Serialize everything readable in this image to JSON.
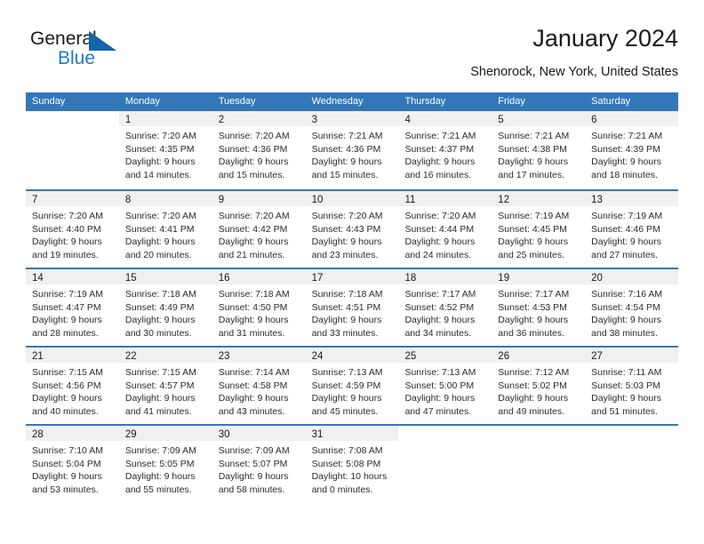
{
  "brand": {
    "name_part1": "General",
    "name_part2": "Blue",
    "accent_color": "#1d7bc4",
    "triangle_color": "#1665a8"
  },
  "header": {
    "title": "January 2024",
    "subtitle": "Shenorock, New York, United States"
  },
  "calendar": {
    "header_bg": "#3277b8",
    "daynum_bg": "#f0f0f0",
    "weekdays": [
      "Sunday",
      "Monday",
      "Tuesday",
      "Wednesday",
      "Thursday",
      "Friday",
      "Saturday"
    ],
    "weeks": [
      [
        {
          "day": "",
          "sunrise": "",
          "sunset": "",
          "daylight_line1": "",
          "daylight_line2": ""
        },
        {
          "day": "1",
          "sunrise": "Sunrise: 7:20 AM",
          "sunset": "Sunset: 4:35 PM",
          "daylight_line1": "Daylight: 9 hours",
          "daylight_line2": "and 14 minutes."
        },
        {
          "day": "2",
          "sunrise": "Sunrise: 7:20 AM",
          "sunset": "Sunset: 4:36 PM",
          "daylight_line1": "Daylight: 9 hours",
          "daylight_line2": "and 15 minutes."
        },
        {
          "day": "3",
          "sunrise": "Sunrise: 7:21 AM",
          "sunset": "Sunset: 4:36 PM",
          "daylight_line1": "Daylight: 9 hours",
          "daylight_line2": "and 15 minutes."
        },
        {
          "day": "4",
          "sunrise": "Sunrise: 7:21 AM",
          "sunset": "Sunset: 4:37 PM",
          "daylight_line1": "Daylight: 9 hours",
          "daylight_line2": "and 16 minutes."
        },
        {
          "day": "5",
          "sunrise": "Sunrise: 7:21 AM",
          "sunset": "Sunset: 4:38 PM",
          "daylight_line1": "Daylight: 9 hours",
          "daylight_line2": "and 17 minutes."
        },
        {
          "day": "6",
          "sunrise": "Sunrise: 7:21 AM",
          "sunset": "Sunset: 4:39 PM",
          "daylight_line1": "Daylight: 9 hours",
          "daylight_line2": "and 18 minutes."
        }
      ],
      [
        {
          "day": "7",
          "sunrise": "Sunrise: 7:20 AM",
          "sunset": "Sunset: 4:40 PM",
          "daylight_line1": "Daylight: 9 hours",
          "daylight_line2": "and 19 minutes."
        },
        {
          "day": "8",
          "sunrise": "Sunrise: 7:20 AM",
          "sunset": "Sunset: 4:41 PM",
          "daylight_line1": "Daylight: 9 hours",
          "daylight_line2": "and 20 minutes."
        },
        {
          "day": "9",
          "sunrise": "Sunrise: 7:20 AM",
          "sunset": "Sunset: 4:42 PM",
          "daylight_line1": "Daylight: 9 hours",
          "daylight_line2": "and 21 minutes."
        },
        {
          "day": "10",
          "sunrise": "Sunrise: 7:20 AM",
          "sunset": "Sunset: 4:43 PM",
          "daylight_line1": "Daylight: 9 hours",
          "daylight_line2": "and 23 minutes."
        },
        {
          "day": "11",
          "sunrise": "Sunrise: 7:20 AM",
          "sunset": "Sunset: 4:44 PM",
          "daylight_line1": "Daylight: 9 hours",
          "daylight_line2": "and 24 minutes."
        },
        {
          "day": "12",
          "sunrise": "Sunrise: 7:19 AM",
          "sunset": "Sunset: 4:45 PM",
          "daylight_line1": "Daylight: 9 hours",
          "daylight_line2": "and 25 minutes."
        },
        {
          "day": "13",
          "sunrise": "Sunrise: 7:19 AM",
          "sunset": "Sunset: 4:46 PM",
          "daylight_line1": "Daylight: 9 hours",
          "daylight_line2": "and 27 minutes."
        }
      ],
      [
        {
          "day": "14",
          "sunrise": "Sunrise: 7:19 AM",
          "sunset": "Sunset: 4:47 PM",
          "daylight_line1": "Daylight: 9 hours",
          "daylight_line2": "and 28 minutes."
        },
        {
          "day": "15",
          "sunrise": "Sunrise: 7:18 AM",
          "sunset": "Sunset: 4:49 PM",
          "daylight_line1": "Daylight: 9 hours",
          "daylight_line2": "and 30 minutes."
        },
        {
          "day": "16",
          "sunrise": "Sunrise: 7:18 AM",
          "sunset": "Sunset: 4:50 PM",
          "daylight_line1": "Daylight: 9 hours",
          "daylight_line2": "and 31 minutes."
        },
        {
          "day": "17",
          "sunrise": "Sunrise: 7:18 AM",
          "sunset": "Sunset: 4:51 PM",
          "daylight_line1": "Daylight: 9 hours",
          "daylight_line2": "and 33 minutes."
        },
        {
          "day": "18",
          "sunrise": "Sunrise: 7:17 AM",
          "sunset": "Sunset: 4:52 PM",
          "daylight_line1": "Daylight: 9 hours",
          "daylight_line2": "and 34 minutes."
        },
        {
          "day": "19",
          "sunrise": "Sunrise: 7:17 AM",
          "sunset": "Sunset: 4:53 PM",
          "daylight_line1": "Daylight: 9 hours",
          "daylight_line2": "and 36 minutes."
        },
        {
          "day": "20",
          "sunrise": "Sunrise: 7:16 AM",
          "sunset": "Sunset: 4:54 PM",
          "daylight_line1": "Daylight: 9 hours",
          "daylight_line2": "and 38 minutes."
        }
      ],
      [
        {
          "day": "21",
          "sunrise": "Sunrise: 7:15 AM",
          "sunset": "Sunset: 4:56 PM",
          "daylight_line1": "Daylight: 9 hours",
          "daylight_line2": "and 40 minutes."
        },
        {
          "day": "22",
          "sunrise": "Sunrise: 7:15 AM",
          "sunset": "Sunset: 4:57 PM",
          "daylight_line1": "Daylight: 9 hours",
          "daylight_line2": "and 41 minutes."
        },
        {
          "day": "23",
          "sunrise": "Sunrise: 7:14 AM",
          "sunset": "Sunset: 4:58 PM",
          "daylight_line1": "Daylight: 9 hours",
          "daylight_line2": "and 43 minutes."
        },
        {
          "day": "24",
          "sunrise": "Sunrise: 7:13 AM",
          "sunset": "Sunset: 4:59 PM",
          "daylight_line1": "Daylight: 9 hours",
          "daylight_line2": "and 45 minutes."
        },
        {
          "day": "25",
          "sunrise": "Sunrise: 7:13 AM",
          "sunset": "Sunset: 5:00 PM",
          "daylight_line1": "Daylight: 9 hours",
          "daylight_line2": "and 47 minutes."
        },
        {
          "day": "26",
          "sunrise": "Sunrise: 7:12 AM",
          "sunset": "Sunset: 5:02 PM",
          "daylight_line1": "Daylight: 9 hours",
          "daylight_line2": "and 49 minutes."
        },
        {
          "day": "27",
          "sunrise": "Sunrise: 7:11 AM",
          "sunset": "Sunset: 5:03 PM",
          "daylight_line1": "Daylight: 9 hours",
          "daylight_line2": "and 51 minutes."
        }
      ],
      [
        {
          "day": "28",
          "sunrise": "Sunrise: 7:10 AM",
          "sunset": "Sunset: 5:04 PM",
          "daylight_line1": "Daylight: 9 hours",
          "daylight_line2": "and 53 minutes."
        },
        {
          "day": "29",
          "sunrise": "Sunrise: 7:09 AM",
          "sunset": "Sunset: 5:05 PM",
          "daylight_line1": "Daylight: 9 hours",
          "daylight_line2": "and 55 minutes."
        },
        {
          "day": "30",
          "sunrise": "Sunrise: 7:09 AM",
          "sunset": "Sunset: 5:07 PM",
          "daylight_line1": "Daylight: 9 hours",
          "daylight_line2": "and 58 minutes."
        },
        {
          "day": "31",
          "sunrise": "Sunrise: 7:08 AM",
          "sunset": "Sunset: 5:08 PM",
          "daylight_line1": "Daylight: 10 hours",
          "daylight_line2": "and 0 minutes."
        },
        {
          "day": "",
          "sunrise": "",
          "sunset": "",
          "daylight_line1": "",
          "daylight_line2": ""
        },
        {
          "day": "",
          "sunrise": "",
          "sunset": "",
          "daylight_line1": "",
          "daylight_line2": ""
        },
        {
          "day": "",
          "sunrise": "",
          "sunset": "",
          "daylight_line1": "",
          "daylight_line2": ""
        }
      ]
    ]
  }
}
